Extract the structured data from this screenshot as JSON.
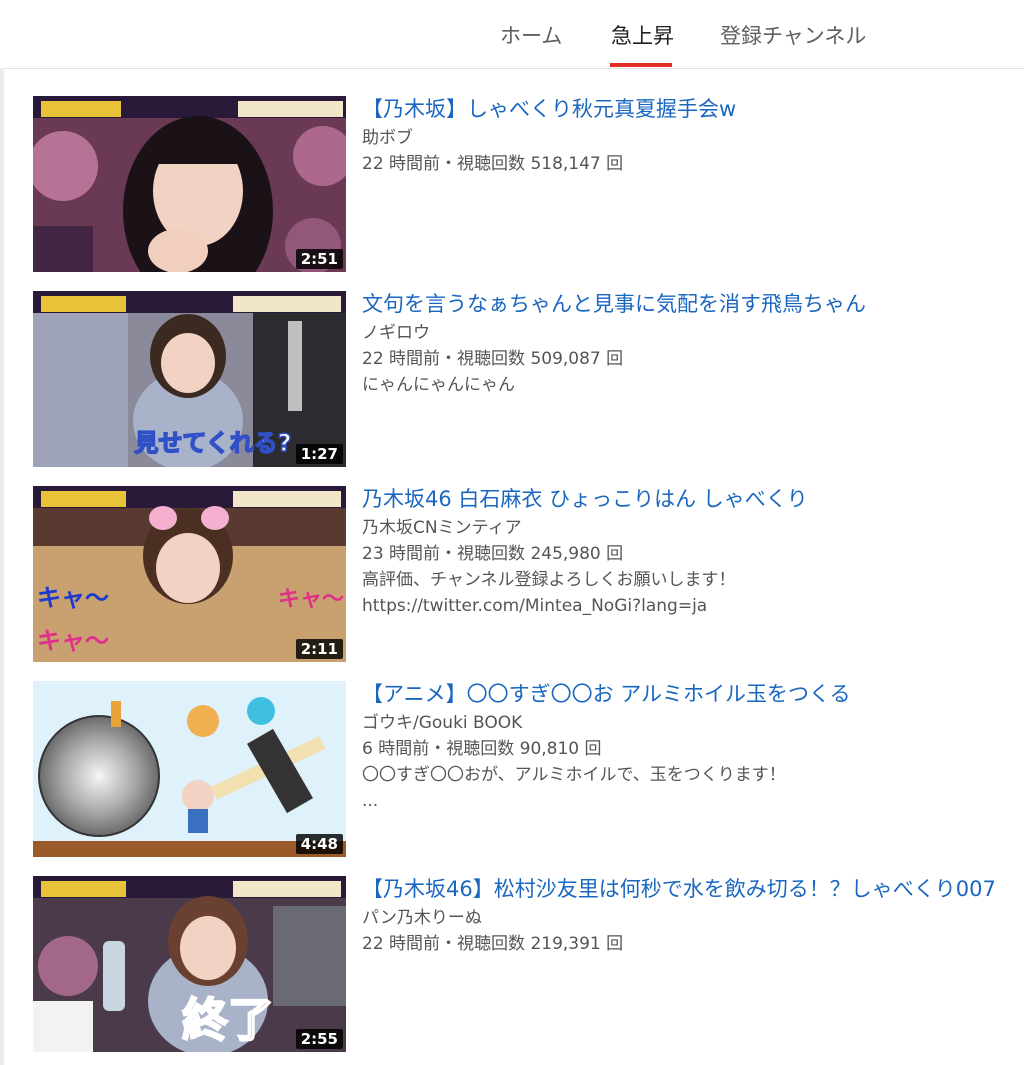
{
  "tabs": [
    {
      "label": "ホーム",
      "active": false
    },
    {
      "label": "急上昇",
      "active": true
    },
    {
      "label": "登録チャンネル",
      "active": false
    }
  ],
  "accent_color": "#e52d27",
  "link_color": "#1a67c0",
  "videos": [
    {
      "title": "【乃木坂】しゃべくり秋元真夏握手会w",
      "channel": "助ボブ",
      "meta": "22 時間前・視聴回数 518,147 回",
      "description": [],
      "duration": "2:51",
      "thumb_caption": ""
    },
    {
      "title": "文句を言うなぁちゃんと見事に気配を消す飛鳥ちゃん",
      "channel": "ノギロウ",
      "meta": "22 時間前・視聴回数 509,087 回",
      "description": [
        "にゃんにゃんにゃん"
      ],
      "duration": "1:27",
      "thumb_caption": "見せてくれる?"
    },
    {
      "title": "乃木坂46 白石麻衣 ひょっこりはん しゃべくり",
      "channel": "乃木坂CNミンティア",
      "meta": "23 時間前・視聴回数 245,980 回",
      "description": [
        "高評価、チャンネル登録よろしくお願いします！",
        "https://twitter.com/Mintea_NoGi?lang=ja"
      ],
      "duration": "2:11",
      "thumb_caption": "キャ〜"
    },
    {
      "title": "【アニメ】〇〇すぎ〇〇お アルミホイル玉をつくる",
      "channel": "ゴウキ/Gouki BOOK",
      "meta": "6 時間前・視聴回数 90,810 回",
      "description": [
        "〇〇すぎ〇〇おが、アルミホイルで、玉をつくります！",
        "..."
      ],
      "duration": "4:48",
      "thumb_caption": ""
    },
    {
      "title": "【乃木坂46】松村沙友里は何秒で水を飲み切る！？しゃべくり007",
      "channel": "パン乃木りーぬ",
      "meta": "22 時間前・視聴回数 219,391 回",
      "description": [],
      "duration": "2:55",
      "thumb_caption": "終了"
    }
  ]
}
